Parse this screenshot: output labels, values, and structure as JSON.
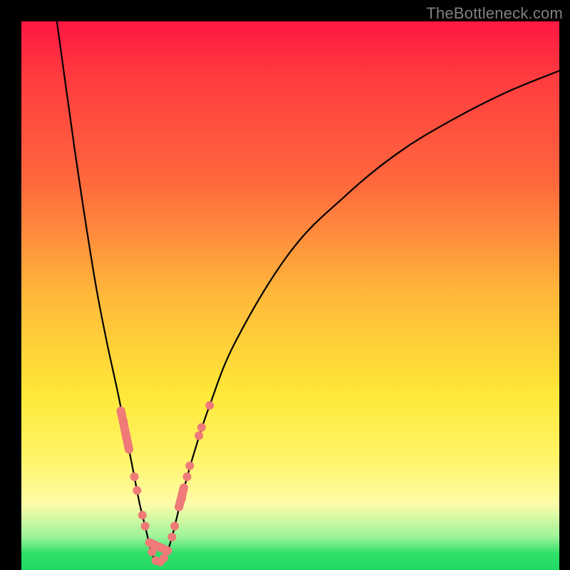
{
  "watermark": "TheBottleneck.com",
  "chart_data": {
    "type": "line",
    "title": "",
    "xlabel": "",
    "ylabel": "",
    "xlim": [
      0,
      100
    ],
    "ylim": [
      0,
      100
    ],
    "note": "Axis values are normalized 0–100 of the plot area (x: left→right, y: bottom→top). The black curve is a V-shaped bottleneck profile with a sharp minimum around x≈25. Background is a vertical heat gradient (red top → green bottom). Pink markers sit on the curve in the low y region near the minimum.",
    "background_gradient_stops": [
      {
        "pos": 0.0,
        "color": "#ff1744"
      },
      {
        "pos": 0.1,
        "color": "#ff3b3f"
      },
      {
        "pos": 0.3,
        "color": "#ff6a3d"
      },
      {
        "pos": 0.5,
        "color": "#ffb93a"
      },
      {
        "pos": 0.68,
        "color": "#ffe838"
      },
      {
        "pos": 0.8,
        "color": "#fff56b"
      },
      {
        "pos": 0.88,
        "color": "#fdfca8"
      },
      {
        "pos": 0.94,
        "color": "#9cf39a"
      },
      {
        "pos": 0.97,
        "color": "#2fe06a"
      },
      {
        "pos": 1.0,
        "color": "#23d863"
      }
    ],
    "series": [
      {
        "name": "bottleneck-curve",
        "x": [
          6.6,
          8,
          10,
          12,
          14,
          16,
          18,
          20,
          21,
          22,
          23,
          24,
          25,
          26,
          27,
          28,
          29,
          30,
          32,
          35,
          40,
          50,
          60,
          70,
          80,
          90,
          100
        ],
        "y": [
          100,
          90,
          76,
          63,
          51,
          41,
          32,
          22,
          17,
          12,
          8,
          4,
          1.5,
          1.5,
          3,
          6,
          10,
          14,
          21,
          30,
          42,
          58,
          68,
          76,
          82,
          87,
          91
        ]
      }
    ],
    "markers": {
      "name": "highlight-points",
      "color": "#ef7a78",
      "radius": 6,
      "points": [
        {
          "x": 18.5,
          "y": 29
        },
        {
          "x": 19.0,
          "y": 27
        },
        {
          "x": 19.5,
          "y": 24.5
        },
        {
          "x": 20.0,
          "y": 22
        },
        {
          "x": 21.0,
          "y": 17
        },
        {
          "x": 21.5,
          "y": 14.5
        },
        {
          "x": 22.5,
          "y": 10
        },
        {
          "x": 23.0,
          "y": 8
        },
        {
          "x": 23.8,
          "y": 5
        },
        {
          "x": 24.3,
          "y": 3.3
        },
        {
          "x": 25.0,
          "y": 1.7
        },
        {
          "x": 25.8,
          "y": 1.5
        },
        {
          "x": 26.5,
          "y": 2.2
        },
        {
          "x": 27.2,
          "y": 3.5
        },
        {
          "x": 28.0,
          "y": 6
        },
        {
          "x": 28.5,
          "y": 8
        },
        {
          "x": 29.3,
          "y": 11.5
        },
        {
          "x": 29.8,
          "y": 13
        },
        {
          "x": 30.8,
          "y": 17
        },
        {
          "x": 31.3,
          "y": 19
        },
        {
          "x": 33.0,
          "y": 24.5
        },
        {
          "x": 33.5,
          "y": 26
        },
        {
          "x": 35.0,
          "y": 30
        }
      ],
      "capsules": [
        {
          "x1": 18.5,
          "y1": 29,
          "x2": 20.0,
          "y2": 22
        },
        {
          "x1": 23.8,
          "y1": 5,
          "x2": 27.2,
          "y2": 3.5
        },
        {
          "x1": 29.3,
          "y1": 11.5,
          "x2": 30.2,
          "y2": 15
        }
      ]
    }
  }
}
